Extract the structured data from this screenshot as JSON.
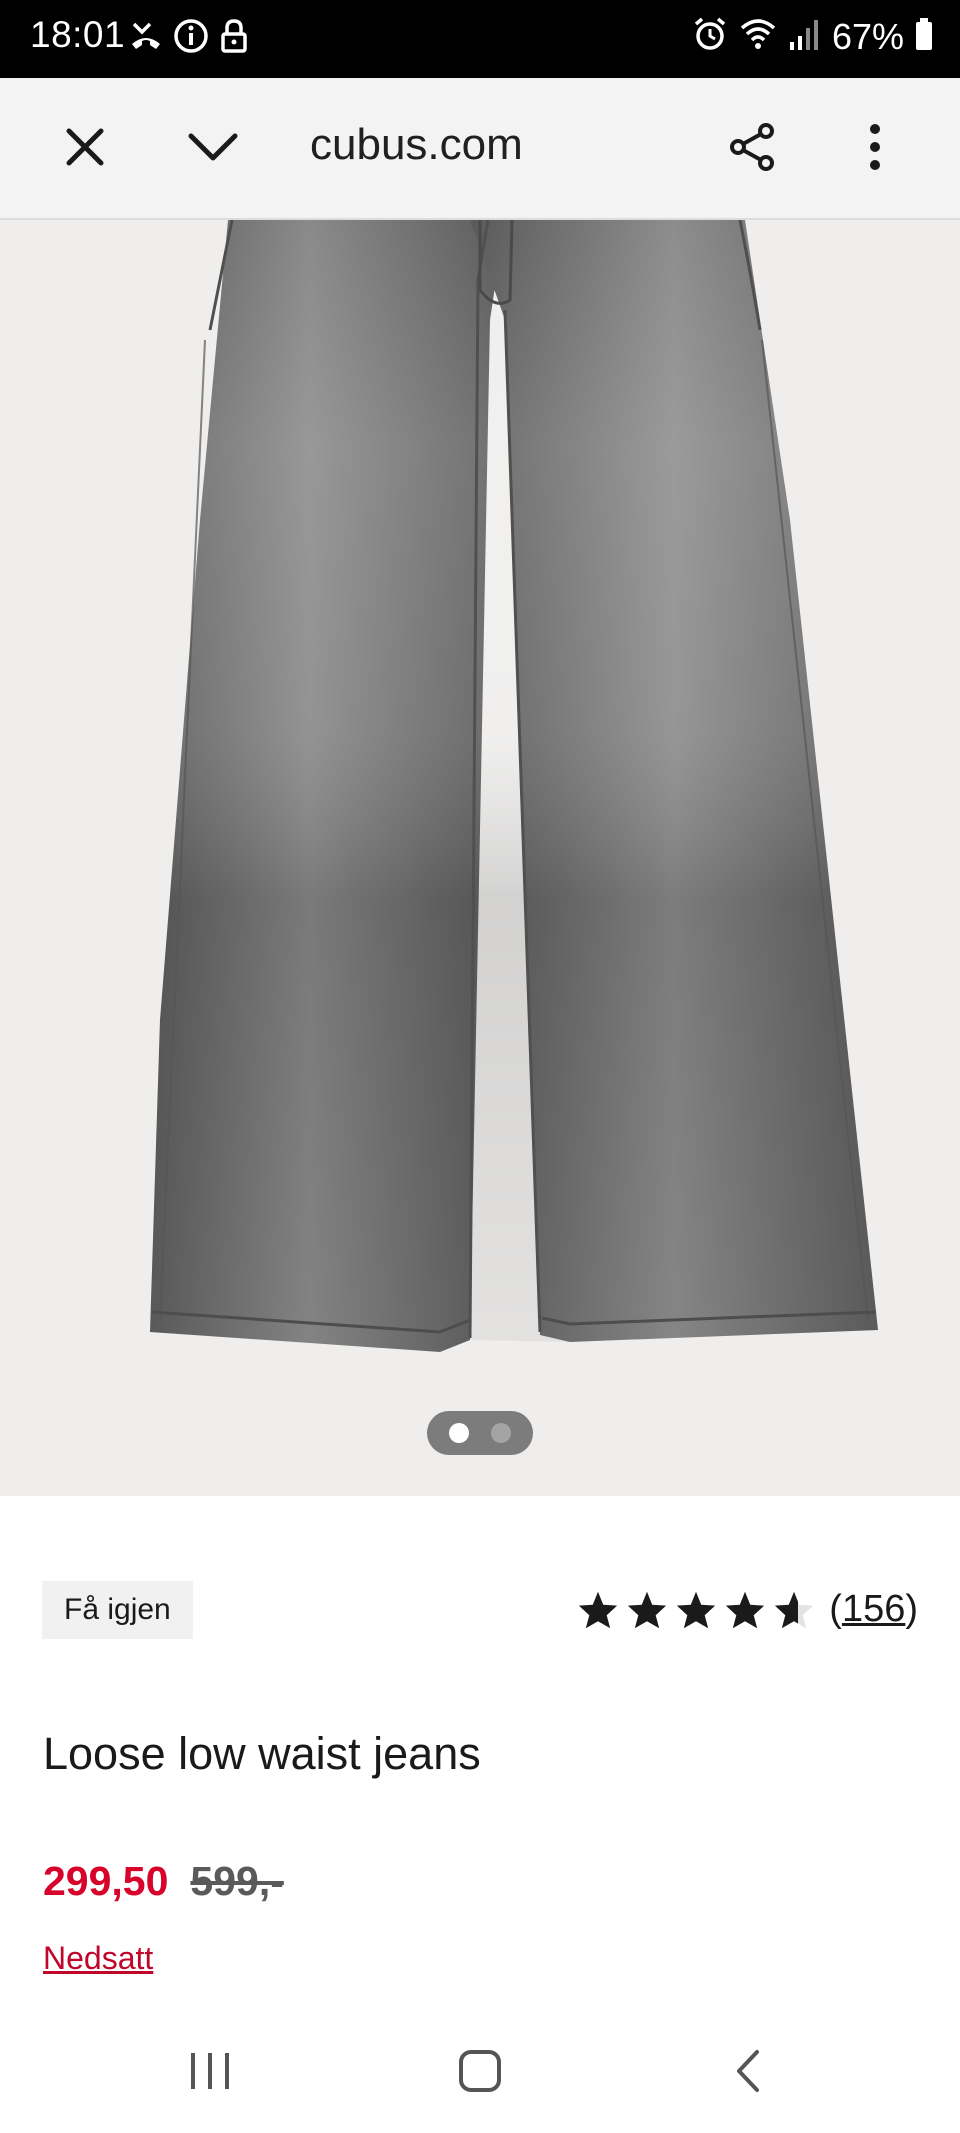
{
  "status_bar": {
    "time": "18:01",
    "battery": "67%",
    "icons": [
      "missed-call-icon",
      "info-icon",
      "lock-icon",
      "alarm-icon",
      "wifi-icon",
      "signal-icon",
      "battery-icon"
    ]
  },
  "browser": {
    "url": "cubus.com",
    "icons": [
      "close-icon",
      "chevron-down-icon",
      "share-icon",
      "more-vert-icon"
    ]
  },
  "gallery": {
    "image": "grey-jeans-image",
    "total_images": 2,
    "current_index": 1
  },
  "product": {
    "badge": "Få igjen",
    "rating": 4.5,
    "rating_max": 5,
    "review_count_open": "(",
    "review_count": "156",
    "review_count_close": ")",
    "title": "Loose low waist jeans",
    "price": "299,50",
    "old_price": "599,-",
    "sale_label": "Nedsatt"
  },
  "colors": {
    "price_red": "#d7032a",
    "jeans_grey": "#6e6e6e",
    "image_bg": "#efeeed"
  },
  "nav": {
    "icons": [
      "recents-icon",
      "home-icon",
      "back-icon"
    ]
  }
}
